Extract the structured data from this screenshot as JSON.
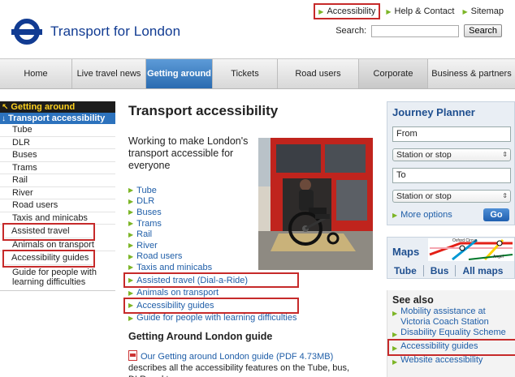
{
  "header": {
    "brand": "Transport for London",
    "top_links": [
      "Accessibility",
      "Help & Contact",
      "Sitemap"
    ],
    "search_label": "Search:",
    "search_button": "Search"
  },
  "nav": {
    "items": [
      "Home",
      "Live travel news",
      "Getting around",
      "Tickets",
      "Road users",
      "Corporate",
      "Business & partners"
    ],
    "active": "Getting around"
  },
  "sidebar": {
    "parent": "Getting around",
    "current": "Transport accessibility",
    "items": [
      "Tube",
      "DLR",
      "Buses",
      "Trams",
      "Rail",
      "River",
      "Road users",
      "Taxis and minicabs",
      "Assisted travel",
      "Animals on transport",
      "Accessibility guides",
      "Guide for people with learning difficulties"
    ]
  },
  "main": {
    "title": "Transport accessibility",
    "subtitle": "Working to make London's transport accessible for everyone",
    "links": [
      "Tube",
      "DLR",
      "Buses",
      "Trams",
      "Rail",
      "River",
      "Road users",
      "Taxis and minicabs",
      "Assisted travel (Dial-a-Ride)",
      "Animals on transport",
      "Accessibility guides",
      "Guide for people with learning difficulties"
    ],
    "guide_heading": "Getting Around London guide",
    "guide_link": "Our Getting around London guide (PDF 4.73MB)",
    "guide_text": " describes all the accessibility features on the Tube, bus, DLR and tram."
  },
  "journey_planner": {
    "title": "Journey Planner",
    "from_value": "From",
    "from_type": "Station or stop",
    "to_value": "To",
    "to_type": "Station or stop",
    "more_options": "More options",
    "go": "Go"
  },
  "maps": {
    "title": "Maps",
    "graphic_labels": [
      "Oxford Circus",
      "Angel"
    ],
    "links": [
      "Tube",
      "Bus",
      "All maps"
    ]
  },
  "see_also": {
    "title": "See also",
    "items": [
      "Mobility assistance at Victoria Coach Station",
      "Disability Equality Scheme",
      "Accessibility guides",
      "Website accessibility"
    ]
  },
  "colors": {
    "tfl_blue": "#113B92",
    "link_blue": "#1f5ea8",
    "active_nav": "#2a6bb0",
    "arrow_green": "#7cb526",
    "highlight_red": "#c62a2a"
  }
}
